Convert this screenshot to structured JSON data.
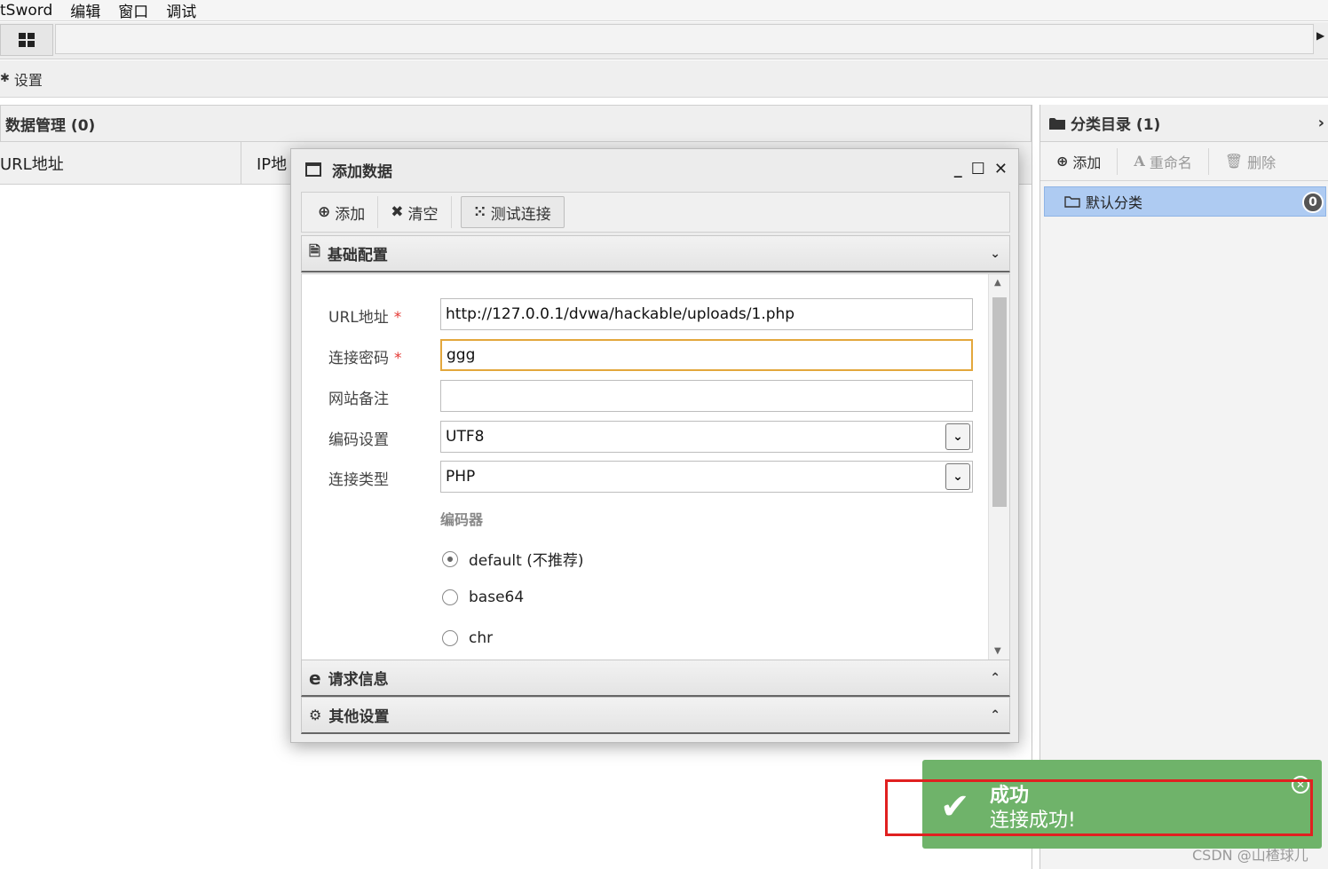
{
  "menu": {
    "app": "tSword",
    "items": [
      "编辑",
      "窗口",
      "调试"
    ]
  },
  "settings_label": "设置",
  "data_panel": {
    "title": "数据管理 (0)",
    "col_url": "URL地址",
    "col_ip": "IP地"
  },
  "category_panel": {
    "title": "分类目录 (1)",
    "buttons": {
      "add": "添加",
      "rename": "重命名",
      "delete": "删除"
    },
    "item": {
      "label": "默认分类",
      "count": "0"
    }
  },
  "dialog": {
    "title": "添加数据",
    "toolbar": {
      "add": "添加",
      "clear": "清空",
      "test": "测试连接"
    },
    "sections": {
      "basic": "基础配置",
      "request": "请求信息",
      "other": "其他设置"
    },
    "form": {
      "url_label": "URL地址",
      "url_value": "http://127.0.0.1/dvwa/hackable/uploads/1.php",
      "password_label": "连接密码",
      "password_value": "ggg",
      "note_label": "网站备注",
      "note_value": "",
      "encoding_label": "编码设置",
      "encoding_value": "UTF8",
      "type_label": "连接类型",
      "type_value": "PHP",
      "encoder_label": "编码器",
      "encoders": [
        {
          "label": "default (不推荐)",
          "checked": true
        },
        {
          "label": "base64",
          "checked": false
        },
        {
          "label": "chr",
          "checked": false
        }
      ]
    }
  },
  "toast": {
    "title": "成功",
    "message": "连接成功!",
    "color": "#6fb36a"
  },
  "watermark": "CSDN @山楂球儿"
}
